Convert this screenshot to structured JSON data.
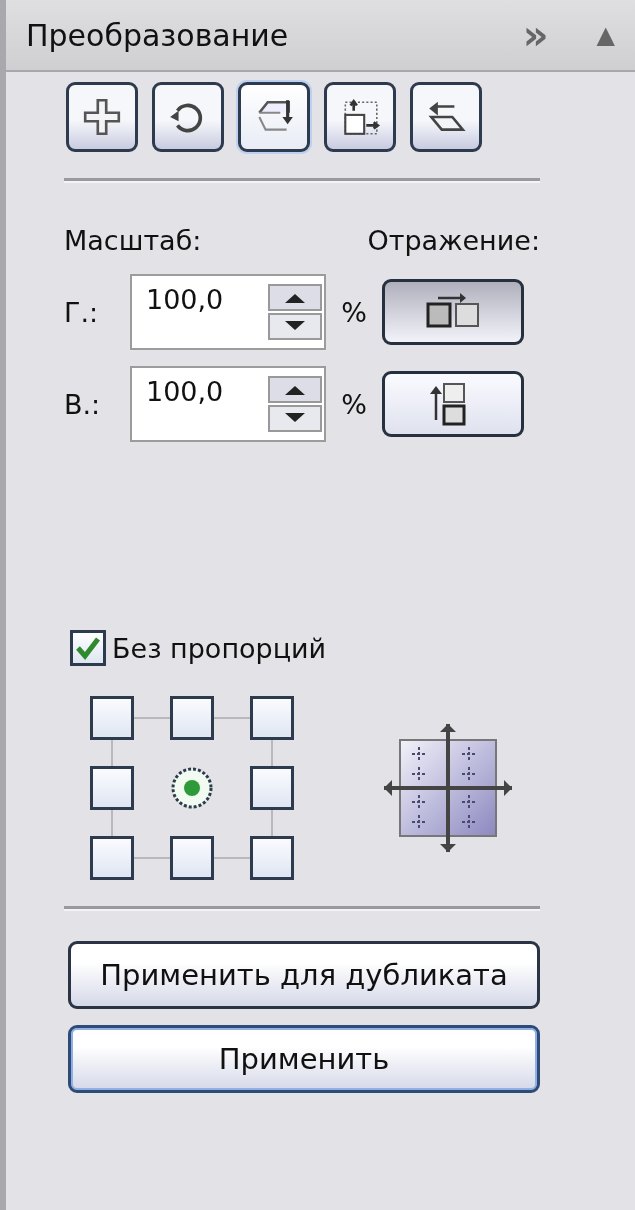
{
  "header": {
    "title": "Преобразование",
    "more": "»",
    "collapse": "▲"
  },
  "toolbar": [
    {
      "kind": "position",
      "selected": false
    },
    {
      "kind": "rotate",
      "selected": false
    },
    {
      "kind": "mirror",
      "selected": true
    },
    {
      "kind": "size",
      "selected": false
    },
    {
      "kind": "skew",
      "selected": false
    }
  ],
  "scale_label": "Масштаб:",
  "mirror_label": "Отражение:",
  "rows": [
    {
      "label": "Г.:",
      "value": "100,0",
      "unit": "%",
      "kind": "horizontal",
      "pressed": true
    },
    {
      "label": "В.:",
      "value": "100,0",
      "unit": "%",
      "kind": "vertical",
      "pressed": false
    }
  ],
  "proportional": {
    "label": "Без пропорций",
    "checked": true
  },
  "anchors": [
    {
      "selected": false
    },
    {
      "selected": false
    },
    {
      "selected": false
    },
    {
      "selected": false
    },
    {
      "selected": true
    },
    {
      "selected": false
    },
    {
      "selected": false
    },
    {
      "selected": false
    },
    {
      "selected": false
    }
  ],
  "buttons": [
    {
      "label": "Применить для дубликата",
      "default": false
    },
    {
      "label": "Применить",
      "default": true
    }
  ]
}
